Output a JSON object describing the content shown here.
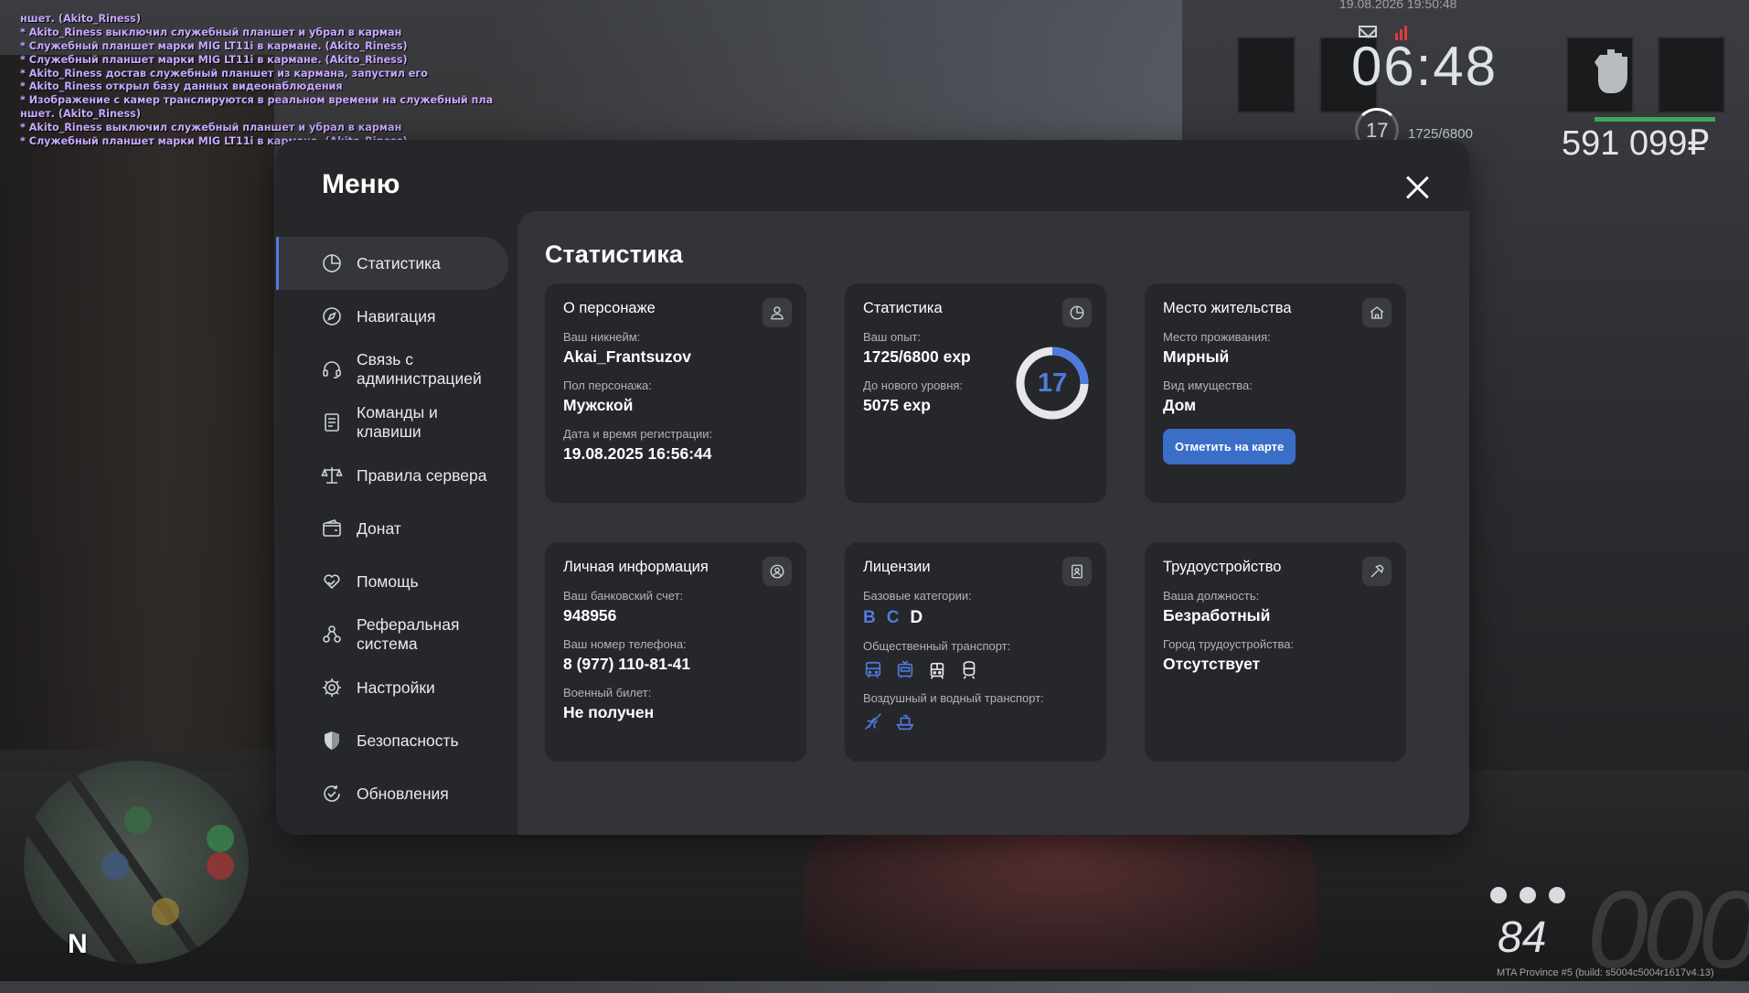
{
  "chat": [
    "ншет. (Akito_Riness)",
    "* Akito_Riness выключил служебный планшет и убрал в карман",
    "* Служебный планшет марки MIG LT11i в кармане. (Akito_Riness)",
    "* Служебный планшет марки MIG LT11i в кармане. (Akito_Riness)",
    "* Akito_Riness достав служебный планшет из кармана, запустил его",
    "* Akito_Riness открыл базу данных видеонаблюдения",
    "* Изображение с камер транслируются в реальном времени на служебный пла",
    "ншет. (Akito_Riness)",
    "* Akito_Riness выключил служебный планшет и убрал в карман",
    "* Служебный планшет марки MIG LT11i в кармане. (Akito_Riness)"
  ],
  "hud": {
    "date": "19.08.2026 19:50:48",
    "time": "06:48",
    "level": "17",
    "exp": "1725/6800",
    "money": "591 099₽",
    "fuel": "84",
    "speed": "000",
    "build": "MTA Province #5 (build: s5004c5004r1617v4.13)",
    "map_north": "N"
  },
  "menu": {
    "title": "Меню",
    "nav": [
      {
        "label": "Статистика",
        "icon": "pie-chart-icon",
        "active": true
      },
      {
        "label": "Навигация",
        "icon": "compass-icon"
      },
      {
        "label": "Связь с администрацией",
        "icon": "headset-icon"
      },
      {
        "label": "Команды и клавиши",
        "icon": "document-icon"
      },
      {
        "label": "Правила сервера",
        "icon": "scales-icon"
      },
      {
        "label": "Донат",
        "icon": "wallet-icon"
      },
      {
        "label": "Помощь",
        "icon": "heart-hand-icon"
      },
      {
        "label": "Реферальная система",
        "icon": "people-icon"
      },
      {
        "label": "Настройки",
        "icon": "gear-icon"
      },
      {
        "label": "Безопасность",
        "icon": "shield-icon"
      },
      {
        "label": "Обновления",
        "icon": "refresh-check-icon"
      }
    ]
  },
  "content": {
    "title": "Статистика",
    "character": {
      "title": "О персонаже",
      "nick_label": "Ваш никнейм:",
      "nick": "Akai_Frantsuzov",
      "gender_label": "Пол персонажа:",
      "gender": "Мужской",
      "reg_label": "Дата и время регистрации:",
      "reg": "19.08.2025 16:56:44"
    },
    "stats": {
      "title": "Статистика",
      "exp_label": "Ваш опыт:",
      "exp": "1725/6800 exp",
      "next_label": "До нового уровня:",
      "next": "5075 exp",
      "level": "17",
      "progress": 0.254
    },
    "residence": {
      "title": "Место жительства",
      "place_label": "Место проживания:",
      "place": "Мирный",
      "property_label": "Вид имущества:",
      "property": "Дом",
      "button": "Отметить на карте"
    },
    "personal": {
      "title": "Личная информация",
      "bank_label": "Ваш банковский счет:",
      "bank": "948956",
      "phone_label": "Ваш номер телефона:",
      "phone": "8 (977) 110-81-41",
      "military_label": "Военный билет:",
      "military": "Не получен"
    },
    "licenses": {
      "title": "Лицензии",
      "base_label": "Базовые категории:",
      "categories": [
        "B",
        "C",
        "D"
      ],
      "public_label": "Общественный транспорт:",
      "air_label": "Воздушный и водный транспорт:"
    },
    "employment": {
      "title": "Трудоустройство",
      "position_label": "Ваша должность:",
      "position": "Безработный",
      "city_label": "Город трудоустройства:",
      "city": "Отсутствует"
    }
  },
  "colors": {
    "accent": "#4f7bdc",
    "button": "#3b6ec7",
    "panel": "#26272b",
    "content": "#333438",
    "chat": "#c8a8ff",
    "health": "#3ea55a"
  }
}
